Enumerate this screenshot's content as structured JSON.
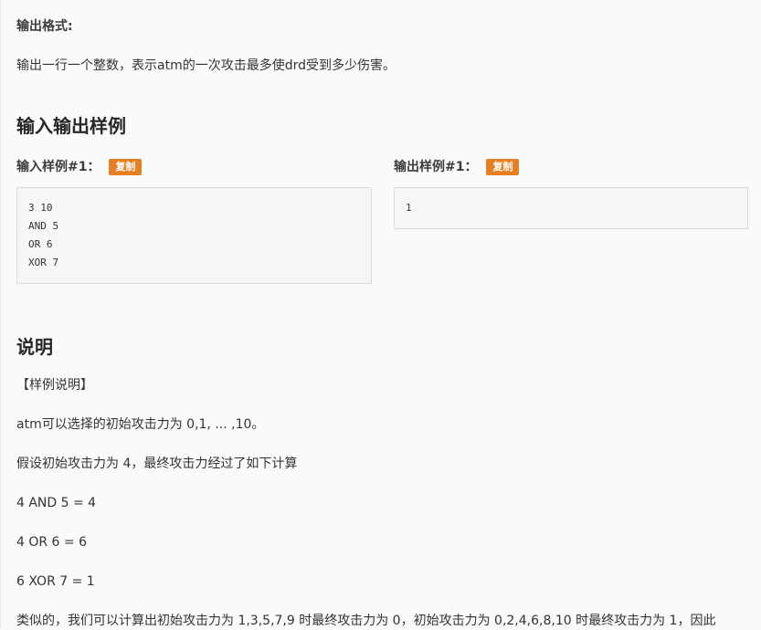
{
  "output_format": {
    "label": "输出格式:",
    "text": "输出一行一个整数，表示atm的一次攻击最多使drd受到多少伤害。"
  },
  "samples_section": {
    "title": "输入输出样例",
    "input": {
      "label": "输入样例#1：",
      "copy_label": "复制",
      "lines": [
        "3 10",
        "AND 5",
        "OR 6",
        "XOR 7"
      ]
    },
    "output": {
      "label": "输出样例#1：",
      "copy_label": "复制",
      "lines": [
        "1"
      ]
    }
  },
  "explanation": {
    "title": "说明",
    "paragraphs": [
      "【样例说明】",
      "atm可以选择的初始攻击力为 0,1, ... ,10。",
      "假设初始攻击力为 4，最终攻击力经过了如下计算",
      "4 AND 5 = 4",
      "4 OR 6 = 6",
      "6 XOR 7 = 1",
      "类似的，我们可以计算出初始攻击力为 1,3,5,7,9 时最终攻击力为 0，初始攻击力为 0,2,4,6,8,10 时最终攻击力为 1，因此"
    ]
  }
}
